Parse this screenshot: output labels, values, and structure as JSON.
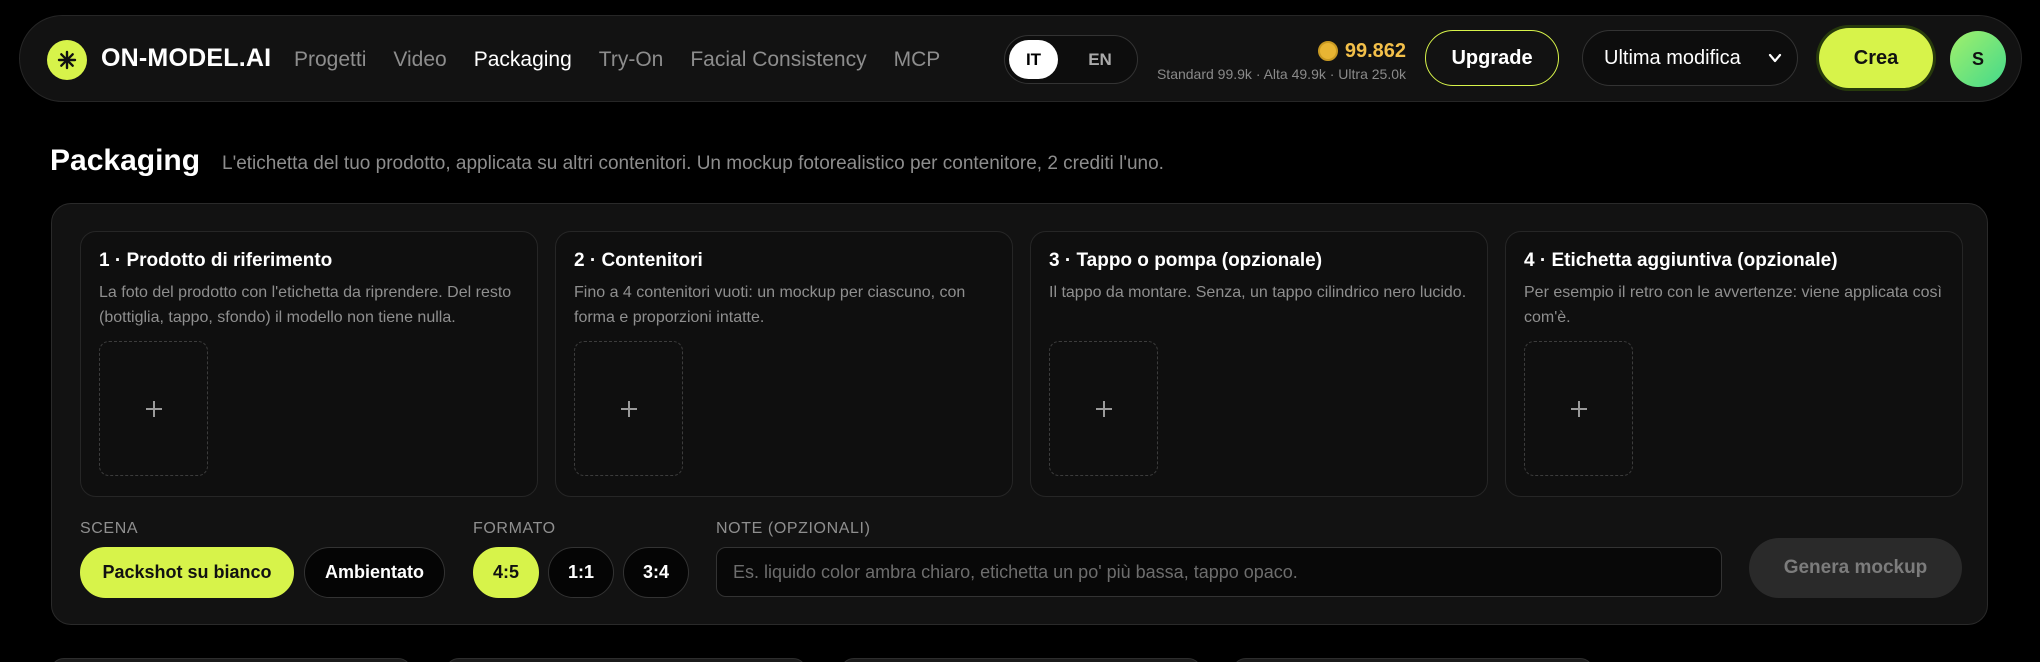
{
  "nav": {
    "logo_text": "ON-MODEL.AI",
    "links": [
      "Progetti",
      "Video",
      "Packaging",
      "Try-On",
      "Facial Consistency",
      "MCP"
    ],
    "active_link": "Packaging",
    "lang": {
      "it": "IT",
      "en": "EN",
      "selected": "IT"
    },
    "credits": {
      "amount": "99.862",
      "breakdown": "Standard 99.9k · Alta 49.9k · Ultra 25.0k"
    },
    "upgrade_label": "Upgrade",
    "sort_select": {
      "value": "Ultima modifica"
    },
    "create_label": "Crea",
    "avatar_initial": "S"
  },
  "page": {
    "title": "Packaging",
    "description": "L'etichetta del tuo prodotto, applicata su altri contenitori. Un mockup fotorealistico per contenitore, 2 crediti l'uno."
  },
  "cards": [
    {
      "title": "1 · Prodotto di riferimento",
      "description": "La foto del prodotto con l'etichetta da riprendere. Del resto (bottiglia, tappo, sfondo) il modello non tiene nulla.",
      "add": "+"
    },
    {
      "title": "2 · Contenitori",
      "description": "Fino a 4 contenitori vuoti: un mockup per ciascuno, con forma e proporzioni intatte.",
      "add": "+"
    },
    {
      "title": "3 · Tappo o pompa (opzionale)",
      "description": "Il tappo da montare. Senza, un tappo cilindrico nero lucido.",
      "add": "+"
    },
    {
      "title": "4 · Etichetta aggiuntiva (opzionale)",
      "description": "Per esempio il retro con le avvertenze: viene applicata così com'è.",
      "add": "+"
    }
  ],
  "scene": {
    "label": "SCENA",
    "options": [
      "Packshot su bianco",
      "Ambientato"
    ],
    "selected": "Packshot su bianco"
  },
  "format": {
    "label": "FORMATO",
    "options": [
      "4:5",
      "1:1",
      "3:4"
    ],
    "selected": "4:5"
  },
  "notes": {
    "label": "NOTE (OPZIONALI)",
    "value": "",
    "placeholder": "Es. liquido color ambra chiaro, etichetta un po' più bassa, tappo opaco."
  },
  "generate_label": "Genera mockup",
  "colors": {
    "accent": "#d7f34a",
    "credits": "#f3c04a",
    "background": "#000000",
    "panel": "#121212"
  }
}
